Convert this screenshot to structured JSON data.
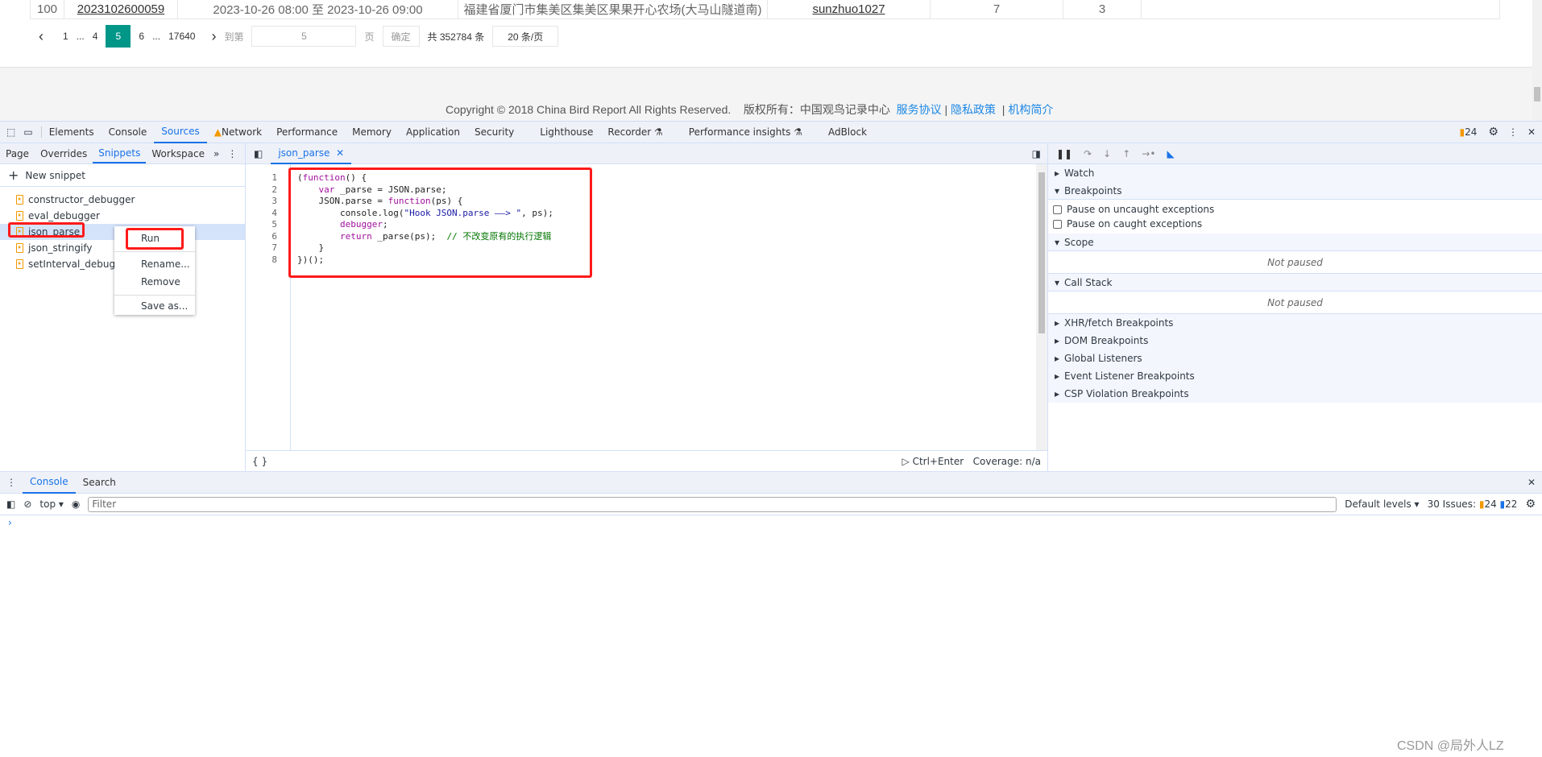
{
  "page": {
    "row": {
      "index": "100",
      "record_id": "2023102600059",
      "time_range": "2023-10-26 08:00 至 2023-10-26 09:00",
      "location": "福建省厦门市集美区集美区果果开心农场(大马山隧道南)",
      "user": "sunzhuo1027",
      "col6": "7",
      "col7": "3"
    },
    "pager": {
      "prev": "‹",
      "pages": [
        "1",
        "...",
        "4",
        "5",
        "6",
        "...",
        "17640"
      ],
      "current": "5",
      "next": "›",
      "goto_label": "到第",
      "goto_value": "5",
      "page_unit": "页",
      "confirm": "确定",
      "total": "共 352784 条",
      "per_page": "20 条/页"
    },
    "footer": {
      "copyright": "Copyright © 2018 China Bird Report All Rights Reserved.",
      "owner": "版权所有：中国观鸟记录中心",
      "links": [
        "服务协议",
        "隐私政策",
        "机构简介"
      ]
    }
  },
  "devtools": {
    "tabs": [
      "Elements",
      "Console",
      "Sources",
      "Network",
      "Performance",
      "Memory",
      "Application",
      "Security",
      "Lighthouse",
      "Recorder",
      "Performance insights",
      "AdBlock"
    ],
    "active_tab": "Sources",
    "issues_count": "24",
    "navigator": {
      "tabs": [
        "Page",
        "Overrides",
        "Snippets",
        "Workspace"
      ],
      "active": "Snippets",
      "new_snippet": "New snippet",
      "snippets": [
        "constructor_debugger",
        "eval_debugger",
        "json_parse",
        "json_stringify",
        "setInterval_debugger"
      ],
      "selected": "json_parse"
    },
    "context_menu": [
      "Run",
      "Rename...",
      "Remove",
      "Save as..."
    ],
    "editor": {
      "tab": "json_parse",
      "lines": [
        "1",
        "2",
        "3",
        "4",
        "5",
        "6",
        "7",
        "8"
      ],
      "run_shortcut": "Ctrl+Enter",
      "coverage": "Coverage: n/a",
      "format": "{ }"
    },
    "debugger": {
      "watch": "Watch",
      "breakpoints": "Breakpoints",
      "pause_uncaught": "Pause on uncaught exceptions",
      "pause_caught": "Pause on caught exceptions",
      "scope": "Scope",
      "not_paused": "Not paused",
      "call_stack": "Call Stack",
      "sections": [
        "XHR/fetch Breakpoints",
        "DOM Breakpoints",
        "Global Listeners",
        "Event Listener Breakpoints",
        "CSP Violation Breakpoints"
      ]
    },
    "drawer": {
      "tabs": [
        "Console",
        "Search"
      ],
      "context": "top",
      "filter_placeholder": "Filter",
      "levels": "Default levels",
      "issues": "30 Issues:",
      "warn_count": "24",
      "info_count": "22",
      "prompt": "›"
    }
  },
  "watermark": "CSDN @局外人LZ"
}
